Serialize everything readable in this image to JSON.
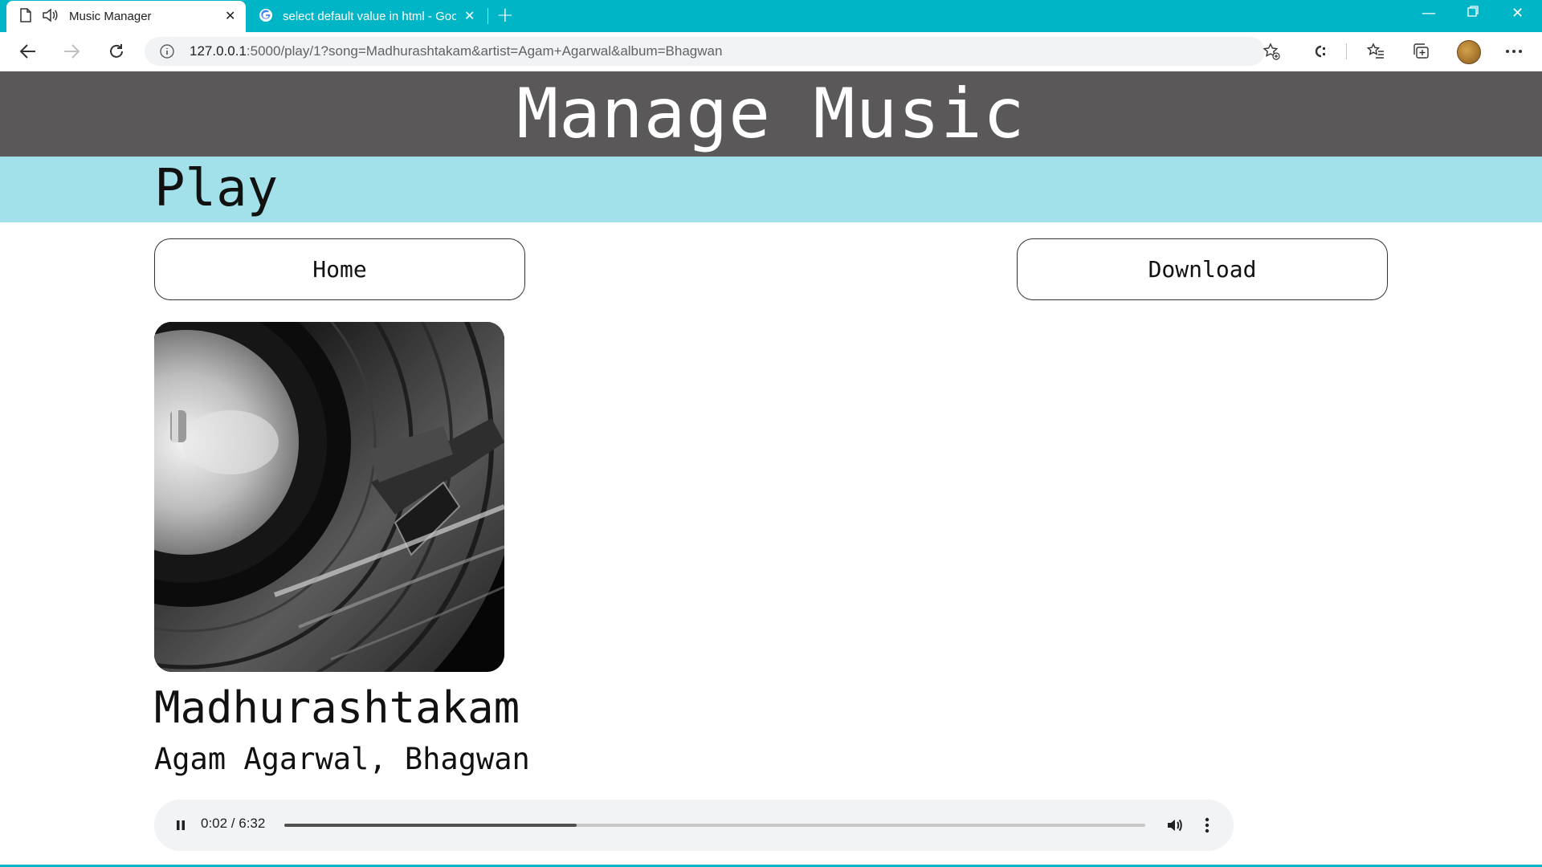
{
  "browser": {
    "tabs": [
      {
        "title": "Music Manager",
        "active": true
      },
      {
        "title": "select default value in html - Goo",
        "active": false
      }
    ],
    "url_host": "127.0.0.1",
    "url_rest": ":5000/play/1?song=Madhurashtakam&artist=Agam+Agarwal&album=Bhagwan",
    "accent_color": "#00b5c6"
  },
  "header": {
    "title": "Manage Music",
    "background": "#5a5858"
  },
  "subheader": {
    "title": "Play",
    "background": "#a2e1ea"
  },
  "buttons": {
    "home": "Home",
    "download": "Download"
  },
  "song": {
    "title": "Madhurashtakam",
    "subtitle": "Agam Agarwal, Bhagwan",
    "cover_icon": "vinyl-record-turntable-image"
  },
  "player": {
    "time": "0:02 / 6:32",
    "buffered_fraction": 0.34,
    "played_fraction": 0.005
  }
}
